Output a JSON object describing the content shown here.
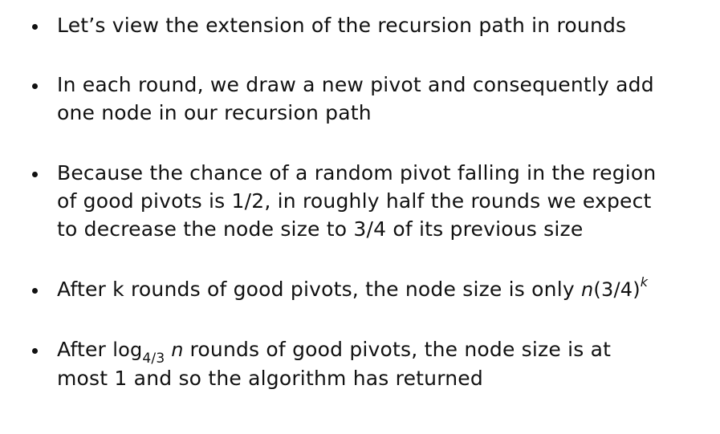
{
  "bullets": [
    {
      "lines": [
        "Let’s view the extension of the recursion path in rounds"
      ]
    },
    {
      "lines": [
        "In each round, we draw a new pivot and consequently add",
        "one node in our recursion path"
      ]
    },
    {
      "lines": [
        "Because the chance of a random pivot falling in the region",
        "of good pivots is 1/2, in roughly half the rounds we expect",
        "to decrease the node size to 3/4 of its previous size"
      ]
    },
    {
      "prefix": "After k rounds of good pivots, the node size is only",
      "math": {
        "var": "n",
        "base": "(3/4)",
        "exponent": "k"
      }
    },
    {
      "prefix": "After",
      "math": {
        "log": "log",
        "sub": "4/3",
        "var": "n"
      },
      "suffix": "rounds of good pivots, the node size is at",
      "line2": "most 1 and so the algorithm has returned"
    }
  ]
}
